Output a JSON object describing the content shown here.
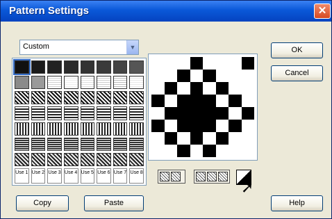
{
  "dialog": {
    "title": "Pattern Settings",
    "close_label": "✕"
  },
  "dropdown": {
    "selected": "Custom",
    "arrow": "▼"
  },
  "palette": {
    "swatches": [
      "#111111",
      "#1a1a1a",
      "#222222",
      "#2a2a2a",
      "#333333",
      "#3a3a3a",
      "#444444",
      "#555555",
      "#8a8a8a",
      "#9a9a9a",
      "#d0d0d0",
      "#eeeeee",
      "#dddddd",
      "#cccccc",
      "#bbbbbb",
      "#e8e8e8",
      "#666666",
      "#888888",
      "#444444",
      "#555555",
      "#333333",
      "#777777",
      "#222222",
      "#999999",
      "#999999",
      "#777777",
      "#aaaaaa",
      "#888888",
      "#bbbbbb",
      "#666666",
      "#cccccc",
      "#aaaaaa",
      "#bbbbbb",
      "#999999",
      "#777777",
      "#888888",
      "#555555",
      "#666666",
      "#444444",
      "#333333",
      "#444444",
      "#555555",
      "#666666",
      "#777777",
      "#999999",
      "#aaaaaa",
      "#888888",
      "#777777",
      "#222222",
      "#333333",
      "#444444",
      "#555555",
      "#666666",
      "#777777",
      "#888888",
      "#999999"
    ],
    "user_slots": [
      "Use 1",
      "Use 2",
      "Use 3",
      "Use 4",
      "Use 5",
      "Use 6",
      "Use 7",
      "Use 8"
    ]
  },
  "editor": {
    "cells": [
      0,
      0,
      0,
      1,
      0,
      0,
      0,
      1,
      0,
      0,
      1,
      0,
      1,
      0,
      0,
      0,
      0,
      1,
      0,
      1,
      0,
      1,
      0,
      0,
      1,
      0,
      1,
      1,
      1,
      0,
      1,
      0,
      0,
      1,
      1,
      1,
      1,
      1,
      0,
      1,
      1,
      0,
      1,
      1,
      1,
      0,
      1,
      0,
      0,
      1,
      0,
      1,
      0,
      1,
      0,
      0,
      0,
      0,
      1,
      0,
      1,
      0,
      0,
      0
    ]
  },
  "buttons": {
    "ok": "OK",
    "cancel": "Cancel",
    "copy": "Copy",
    "paste": "Paste",
    "help": "Help"
  },
  "tools": [
    "flip-tool",
    "rotate-tool",
    "invert-tool"
  ],
  "colors": {
    "dialog_bg": "#ECE9D8",
    "titlebar": "#0A58D8",
    "close": "#D74A22"
  }
}
